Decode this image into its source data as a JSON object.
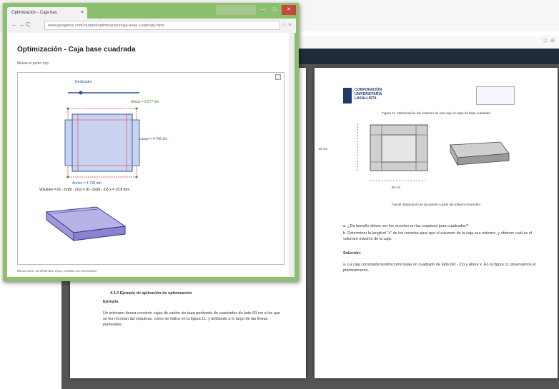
{
  "geogebra_window": {
    "tab_label": "Optimización - Caja bas",
    "tab_close": "×",
    "url": "www.geogebra.com/student/optimizacion/caja-base-cuadrada.html",
    "page_title": "Optimización - Caja base cuadrada",
    "subtitle": "Mueve el punto rojo",
    "slider_label": "Deslizador",
    "altura_label": "Altura = 0.577 dm",
    "largo_label": "Largo = 4.796 dm",
    "ancho_label": "Ancho = 4.796 dm",
    "volumen_label": "Volumen = (6 - 2x)(6 - 2x)x = (6 - 2x)(6 - 2x)·x = 15.8 dm³",
    "footer": "Elena Usón, 18 diciembre 2014, Creado con GeoGebra",
    "window_buttons": [
      "",
      "—",
      "□",
      "✕"
    ]
  },
  "pdf_page_left": {
    "heading": "4.3.3  Ejemplo de aplicación de optimización",
    "subheading": "Ejemplo.",
    "body": "Un artesano desea construir cajas de cartón sin tapa partiendo de cuadrados de lado 60 cm a los que se les recortan las esquinas, como se indica en la figura 11, y doblando a lo largo de las líneas punteadas."
  },
  "pdf_page_right": {
    "logo_text": "CORPORACIÓN UNIVERSITARIA LASALLISTA",
    "figure_caption": "Figura 11. Optimización del volumen de una caja sin tapa de base cuadrada",
    "figure_caption_bottom": "Fuente: Elaboración de los autores a partir del software GeoGebra",
    "dim_left": "60 cm",
    "dim_bottom": "60 cm",
    "question_a": "a.  ¿De tamaño deben ser los recortes en las esquinas para cuadrados?",
    "question_b": "b.  Determinar la longitud \"x\" de los recortes para que el volumen de la caja sea máximo, y obtener cuál es el volumen máximo de la caja.",
    "solucion": "Solución:",
    "answer_a": "a.  La caja construida tendrá como base un cuadrado de lado (60 - 2x) y altura x. En la figura 11 observamos el planteamiento."
  },
  "colors": {
    "window_green": "#8cbf6e",
    "viewer_bar": "#1d2b3b",
    "box_fill": "#c9d3ef",
    "box_stroke": "#2a4fa0",
    "cut_stroke": "#d33"
  }
}
